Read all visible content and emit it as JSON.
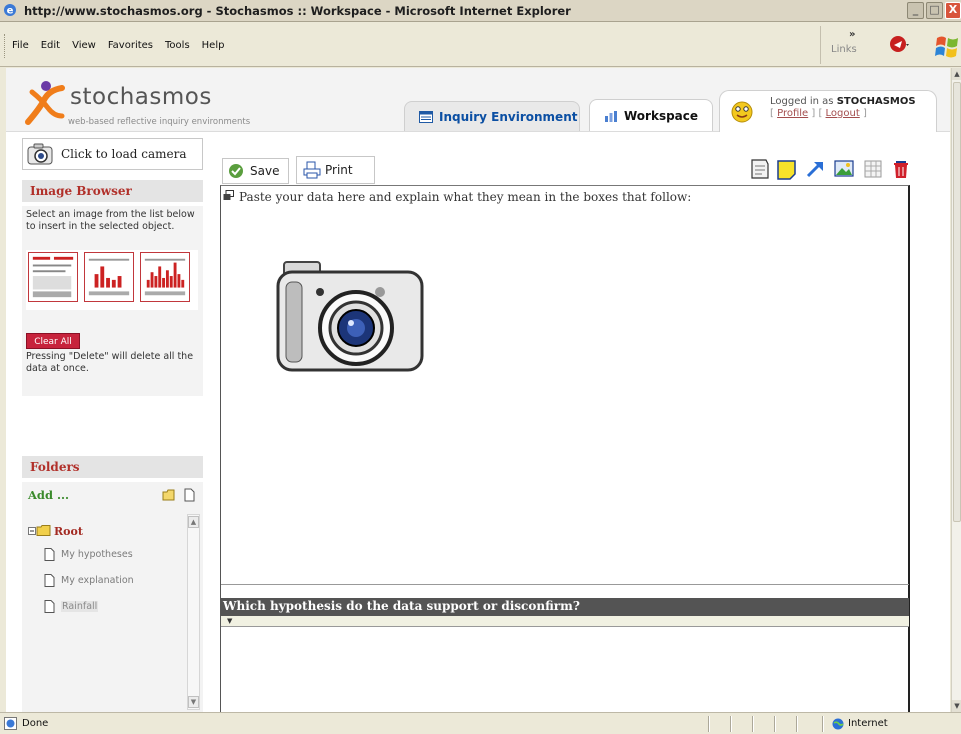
{
  "window": {
    "title": "http://www.stochasmos.org - Stochasmos :: Workspace - Microsoft Internet Explorer",
    "minimize": "_",
    "maximize": "□",
    "close": "X"
  },
  "menu": {
    "items": [
      "File",
      "Edit",
      "View",
      "Favorites",
      "Tools",
      "Help"
    ],
    "links_label": "Links",
    "chevron": "»"
  },
  "header": {
    "logo_text": "stochasmos",
    "logo_sub": "web-based reflective inquiry environments",
    "tabs": [
      {
        "label": "Inquiry Environment",
        "icon": "calendar-icon"
      },
      {
        "label": "Workspace",
        "icon": "chart-icon"
      }
    ],
    "user": {
      "logged_prefix": "Logged in as",
      "username": "STOCHASMOS",
      "profile_link": "Profile",
      "logout_link": "Logout",
      "bracket_open": "[ ",
      "bracket_mid": " ] [ ",
      "bracket_close": " ]"
    }
  },
  "sidebar": {
    "camera_label": "Click to load camera",
    "image_browser": {
      "title": "Image Browser",
      "instructions": "Select an image from the list below to insert in the selected object.",
      "clear_all": "Clear All",
      "note": "Pressing \"Delete\" will delete all the data at once."
    },
    "folders": {
      "title": "Folders",
      "add_label": "Add ...",
      "root": "Root",
      "items": [
        "My hypotheses",
        "My explanation",
        "Rainfall"
      ]
    }
  },
  "toolbar": {
    "save_label": "Save",
    "print_label": "Print",
    "tools": [
      "note-icon",
      "sticky-note-icon",
      "arrow-icon",
      "image-icon",
      "table-icon",
      "trash-icon"
    ]
  },
  "workspace": {
    "box1_prompt": "Paste your data here and explain what they mean in the boxes that follow:",
    "box2_prompt": "Which hypothesis do the data support or disconfirm?"
  },
  "status": {
    "done": "Done",
    "zone": "Internet"
  },
  "colors": {
    "accent_red": "#b1302a",
    "clear_all_red": "#c7233c",
    "tab_blue": "#0b4fa3",
    "add_green": "#3a8a2b"
  }
}
